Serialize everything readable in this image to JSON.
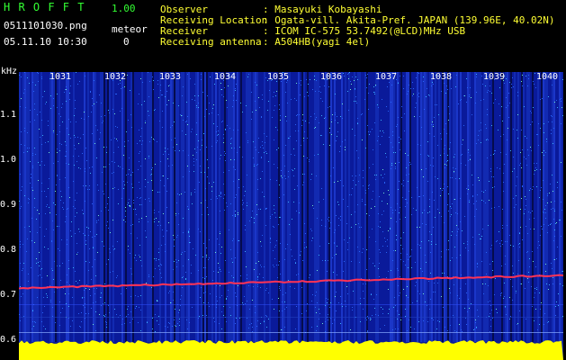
{
  "header": {
    "app_title": "H R O F F T",
    "version": "1.00",
    "filename": "0511101030.png",
    "timestamp": "05.11.10 10:30",
    "meteor_label": "meteor",
    "meteor_count": "0",
    "info_labels": [
      "Observer",
      "Receiving Location",
      "Receiver",
      "Receiving antenna"
    ],
    "info_values": [
      ": Masayuki Kobayashi",
      ": Ogata-vill. Akita-Pref. JAPAN (139.96E, 40.02N)",
      ": ICOM IC-575 53.7492(@LCD)MHz USB",
      ": A504HB(yagi 4el)"
    ]
  },
  "chart_data": {
    "type": "heatmap",
    "ylabel": "kHz",
    "y_ticks": [
      "1.1",
      "1.0",
      "0.9",
      "0.8",
      "0.7",
      "0.6"
    ],
    "x_ticks": [
      "1031",
      "1032",
      "1033",
      "1034",
      "1035",
      "1036",
      "1037",
      "1038",
      "1039",
      "1040"
    ],
    "colors": {
      "background": "#0a1a9a",
      "signal": "#ff3355",
      "noise_band": "#ffff00",
      "speckle": "#40c0ff"
    }
  }
}
